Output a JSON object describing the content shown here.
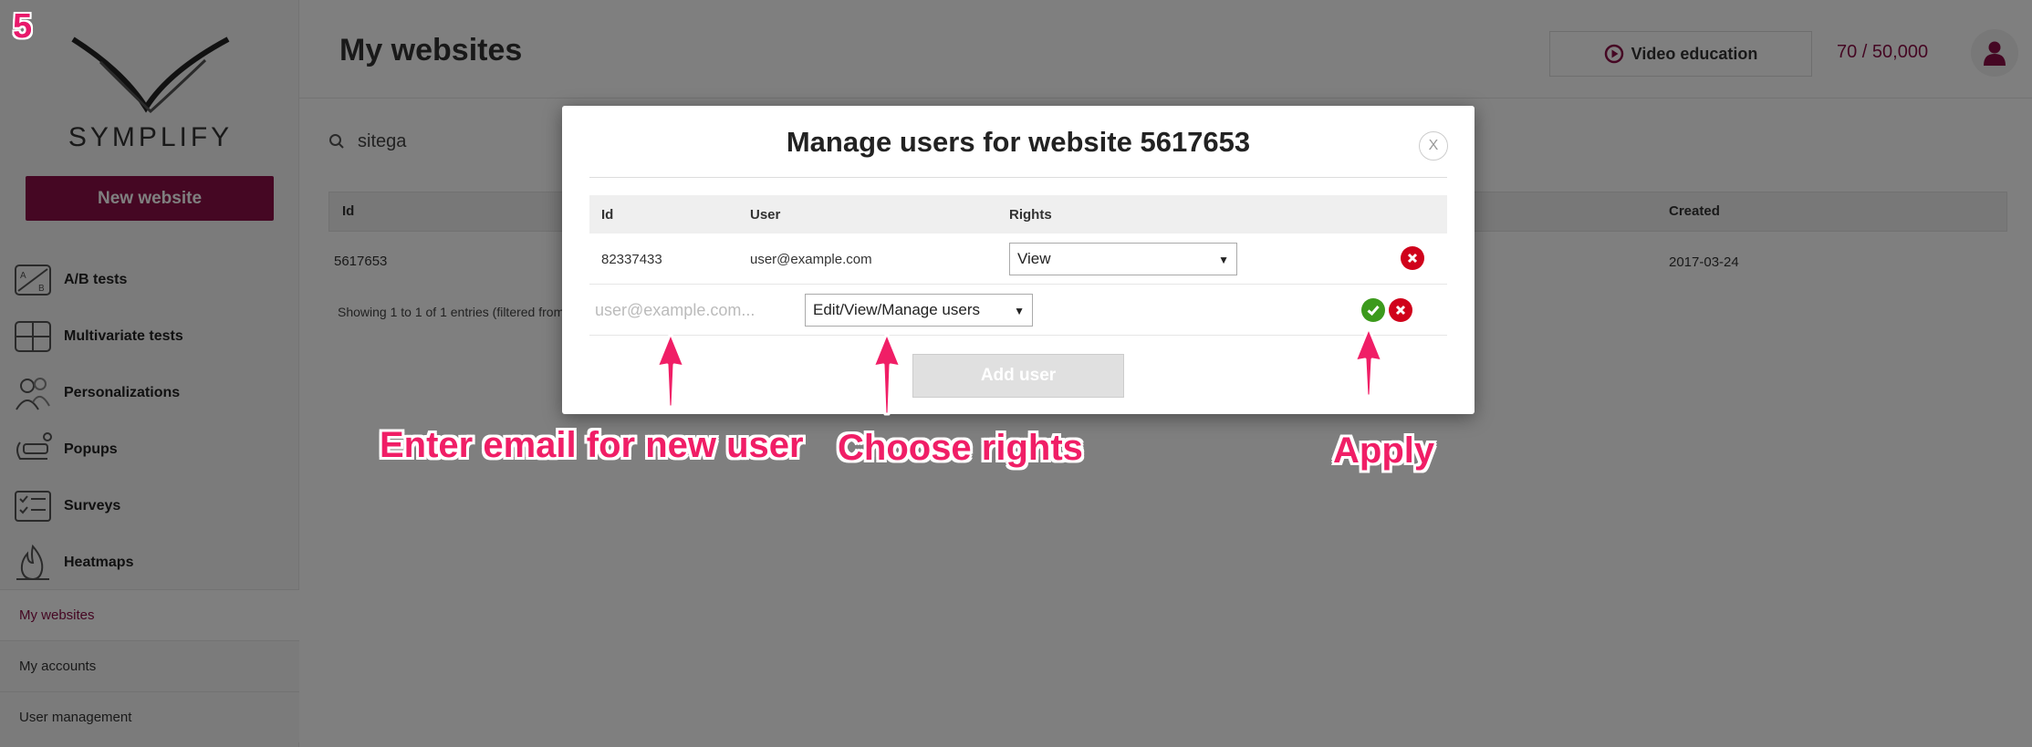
{
  "step_number": "5",
  "brand": {
    "name": "SYMPLIFY"
  },
  "sidebar": {
    "new_website_label": "New website",
    "items": [
      {
        "label": "A/B tests",
        "icon": "ab-tests-icon"
      },
      {
        "label": "Multivariate tests",
        "icon": "multivariate-icon"
      },
      {
        "label": "Personalizations",
        "icon": "personalization-icon"
      },
      {
        "label": "Popups",
        "icon": "popup-icon"
      },
      {
        "label": "Surveys",
        "icon": "survey-icon"
      },
      {
        "label": "Heatmaps",
        "icon": "heatmap-icon"
      }
    ],
    "subitems": [
      {
        "label": "My websites",
        "active": true
      },
      {
        "label": "My accounts",
        "active": false
      },
      {
        "label": "User management",
        "active": false
      }
    ]
  },
  "header": {
    "title": "My websites",
    "video_label": "Video education",
    "quota": "70 / 50,000"
  },
  "search": {
    "value": "sitega"
  },
  "websites_table": {
    "columns": {
      "id": "Id",
      "created": "Created"
    },
    "rows": [
      {
        "id": "5617653",
        "created": "2017-03-24"
      }
    ],
    "showing": "Showing 1 to 1 of 1 entries (filtered from"
  },
  "modal": {
    "title": "Manage users for website 5617653",
    "close_label": "X",
    "columns": {
      "id": "Id",
      "user": "User",
      "rights": "Rights"
    },
    "rows": [
      {
        "id": "82337433",
        "user": "user@example.com",
        "rights": "View"
      }
    ],
    "new_user": {
      "email_placeholder": "user@example.com...",
      "rights": "Edit/View/Manage users"
    },
    "add_user_label": "Add user"
  },
  "annotations": {
    "email": "Enter email for new user",
    "rights": "Choose rights",
    "apply": "Apply"
  },
  "colors": {
    "brand": "#8a0f46",
    "annotation": "#f01e66",
    "delete": "#d0021b",
    "apply": "#3c9a1c"
  }
}
